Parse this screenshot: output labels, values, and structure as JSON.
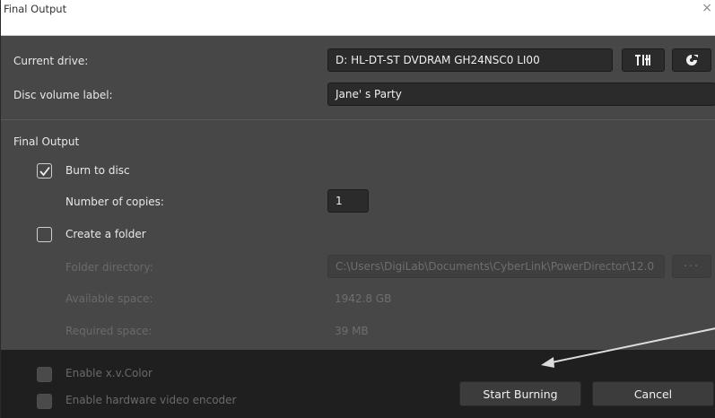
{
  "window": {
    "title": "Final Output",
    "close_glyph": "×"
  },
  "drive": {
    "label": "Current drive:",
    "value": "D: HL-DT-ST DVDRAM GH24NSC0 LI00",
    "settings_icon": "disc-settings-icon",
    "eject_icon": "eject-icon"
  },
  "volume": {
    "label": "Disc volume label:",
    "value": "Jane' s Party"
  },
  "section": {
    "title": "Final Output"
  },
  "burn": {
    "label": "Burn to disc",
    "checked": true
  },
  "copies": {
    "label": "Number of copies:",
    "value": "1"
  },
  "folder": {
    "label": "Create a folder",
    "checked": false
  },
  "folder_dir": {
    "label": "Folder directory:",
    "value": "C:\\Users\\DigiLab\\Documents\\CyberLink\\PowerDirector\\12.0",
    "browse": "···"
  },
  "available": {
    "label": "Available space:",
    "value": "1942.8 GB"
  },
  "required": {
    "label": "Required space:",
    "value": "39 MB"
  },
  "footer": {
    "xvcolor_label": "Enable x.v.Color",
    "hw_encoder_label": "Enable hardware video encoder",
    "start_label": "Start Burning",
    "cancel_label": "Cancel"
  },
  "colors": {
    "arrow": "#dcdcdc",
    "footer_bg": "#1f1f1f",
    "panel_bg": "#474747"
  }
}
